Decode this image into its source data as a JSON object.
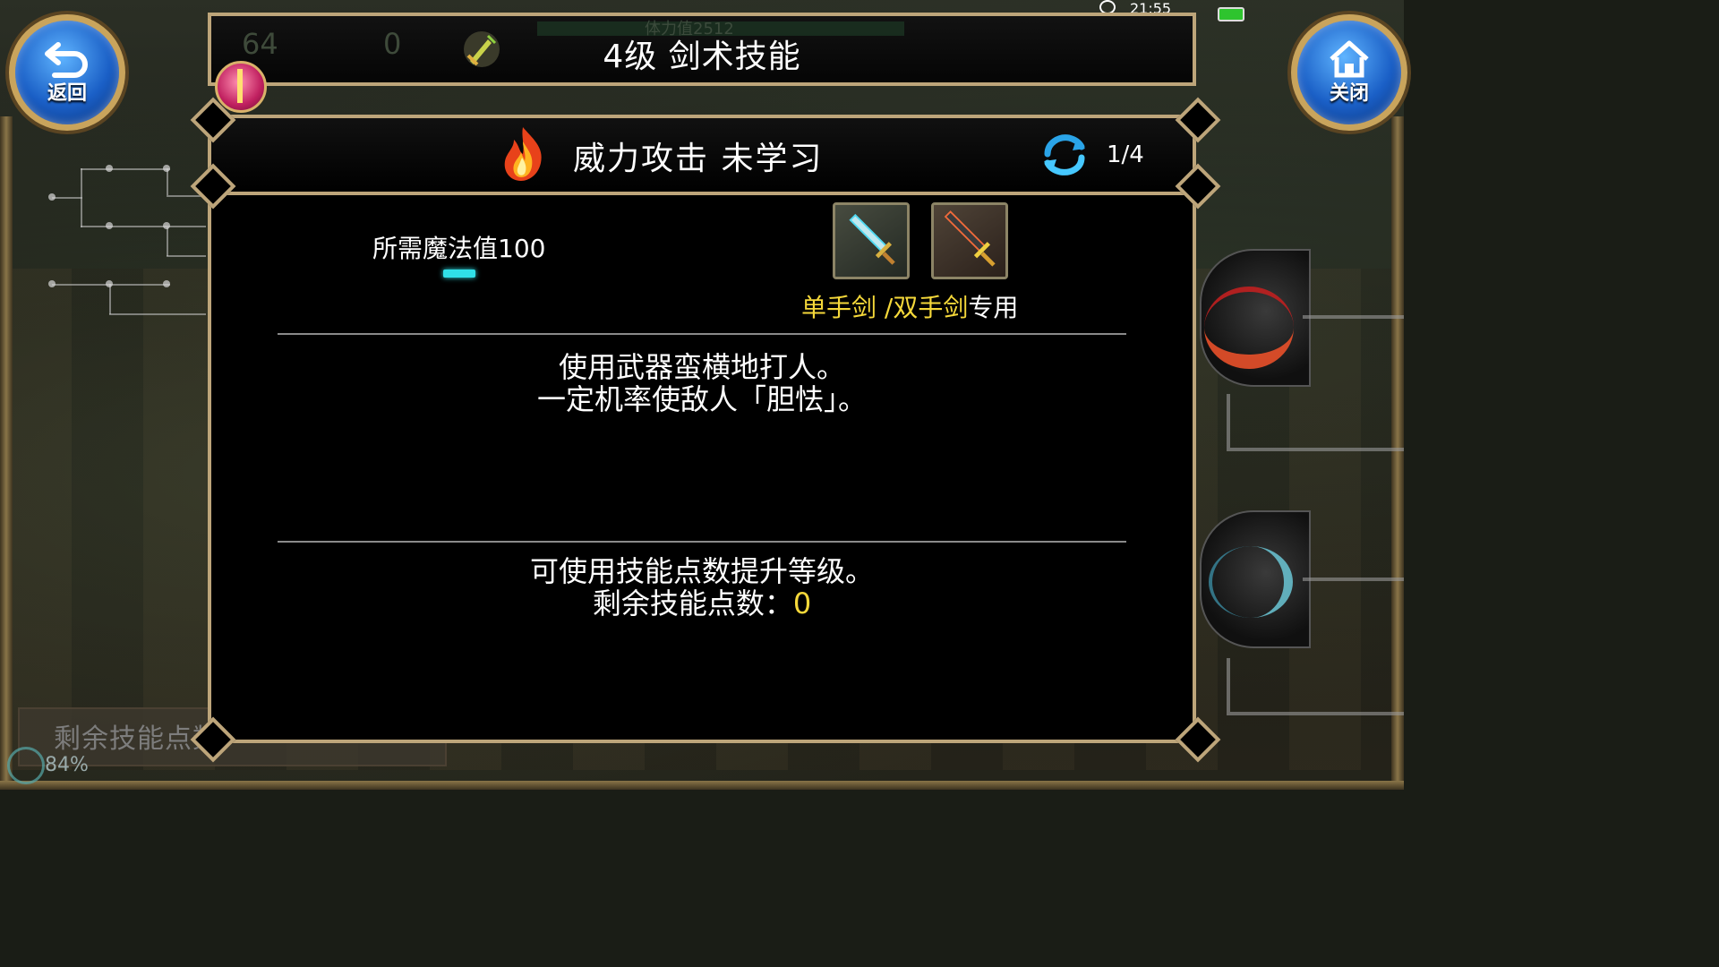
{
  "status_bar": {
    "time": "21:55"
  },
  "hud": {
    "back_label": "返回",
    "close_label": "关闭",
    "title": "4级 剑术技能",
    "faded_level": "64",
    "faded_potion": "0",
    "faded_hp": "体力值2512"
  },
  "skill": {
    "name_status": "威力攻击 未学习",
    "page": "1/4",
    "mp_required": "所需魔法值100",
    "weapon_primary": "单手剑 /双手剑",
    "weapon_suffix": "专用",
    "desc_line1": "使用武器蛮横地打人。",
    "desc_line2": "一定机率使敌人「胆怯」。",
    "upgrade_line": "可使用技能点数提升等级。",
    "remaining_label": "剩余技能点数：",
    "remaining_value": "0"
  },
  "background": {
    "remaining_label_faded": "剩余技能点数",
    "percent": "84%"
  },
  "colors": {
    "gold_frame": "#bda57a",
    "highlight_yellow": "#f5d83a",
    "mp_cyan": "#30e0e8",
    "button_blue": "#1a5fc6"
  }
}
